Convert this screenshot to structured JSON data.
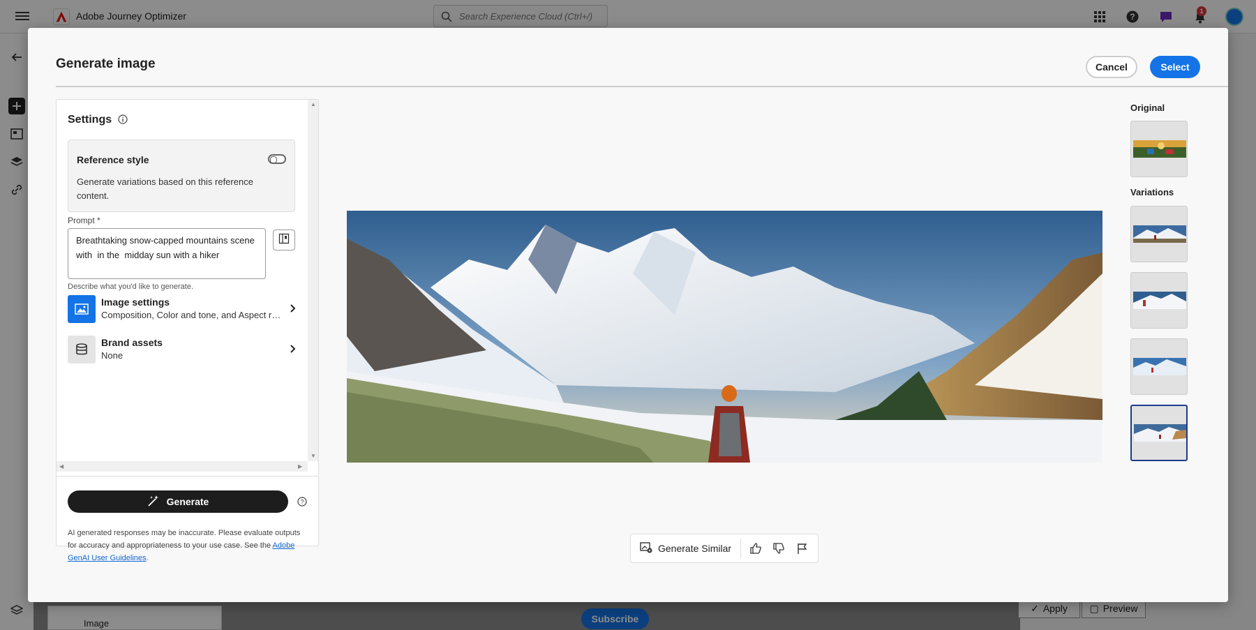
{
  "topbar": {
    "app_name": "Adobe Journey Optimizer",
    "search_placeholder": "Search Experience Cloud (Ctrl+/)",
    "notification_count": "1"
  },
  "background": {
    "strip_label": "Image",
    "subscribe_label": "Subscribe",
    "apply_label": "Apply",
    "preview_label": "Preview"
  },
  "modal": {
    "title": "Generate image",
    "cancel_label": "Cancel",
    "select_label": "Select"
  },
  "settings": {
    "title": "Settings",
    "reference_style": {
      "title": "Reference style",
      "description": "Generate variations based on this reference content.",
      "enabled": false
    },
    "prompt": {
      "label": "Prompt",
      "required_marker": "*",
      "value": "Breathtaking snow-capped mountains scene with  in the  midday sun with a hiker",
      "help": "Describe what you'd like to generate."
    },
    "image_settings": {
      "title": "Image settings",
      "subtitle": "Composition, Color and tone, and Aspect ratio"
    },
    "brand_assets": {
      "title": "Brand assets",
      "subtitle": "None"
    },
    "generate_label": "Generate",
    "disclaimer_prefix": "AI generated responses may be inaccurate. Please evaluate outputs for accuracy and appropriateness to your use case. See the ",
    "disclaimer_link": "Adobe GenAI User Guidelines",
    "disclaimer_suffix": "."
  },
  "actions": {
    "generate_similar_label": "Generate Similar"
  },
  "sidebar": {
    "original_label": "Original",
    "variations_label": "Variations",
    "selected_variation": 4
  },
  "colors": {
    "accent": "#1473e6",
    "generate_button": "#1d1d1d",
    "selected_thumb_border": "#1e3a8a"
  }
}
